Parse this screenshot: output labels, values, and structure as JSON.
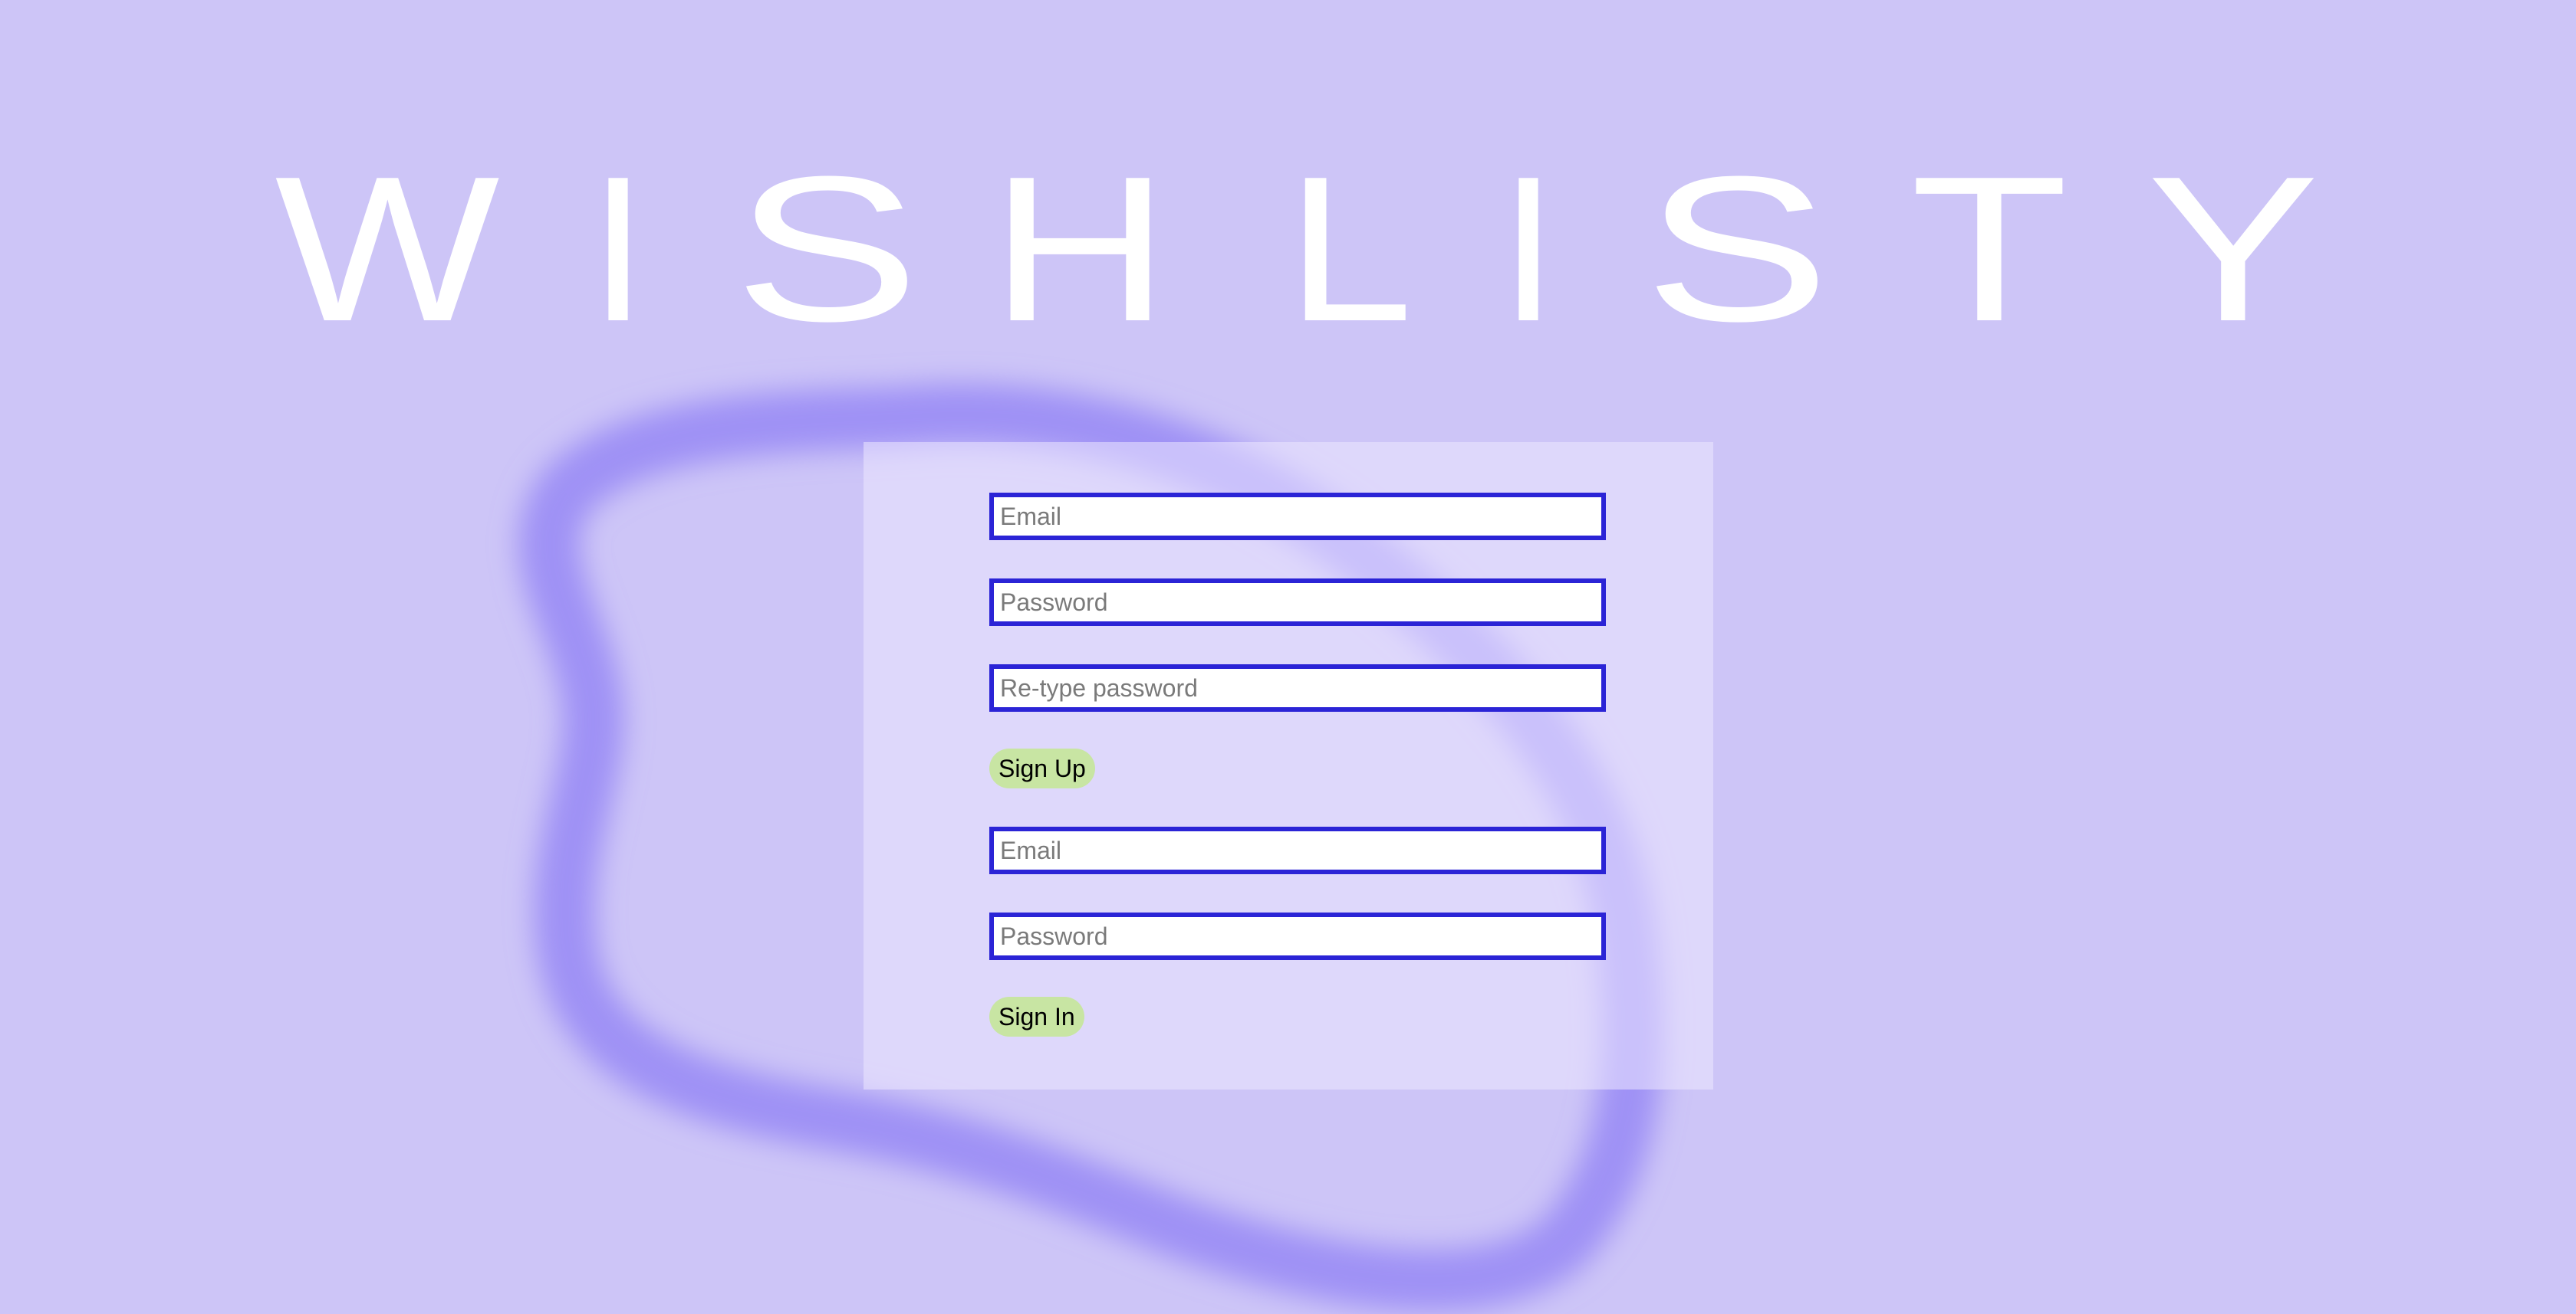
{
  "brand": {
    "name": "WISHLISTY",
    "letters": [
      "W",
      "I",
      "S",
      "H",
      "L",
      "I",
      "S",
      "T",
      "Y"
    ],
    "color": "#ffffff"
  },
  "colors": {
    "background": "#cdc5f7",
    "blob": "#9a8cf5",
    "input_border": "#2b24d6",
    "button": "#c8e5a3"
  },
  "signup": {
    "email_placeholder": "Email",
    "password_placeholder": "Password",
    "retype_placeholder": "Re-type password",
    "button_label": "Sign Up"
  },
  "signin": {
    "email_placeholder": "Email",
    "password_placeholder": "Password",
    "button_label": "Sign In"
  }
}
